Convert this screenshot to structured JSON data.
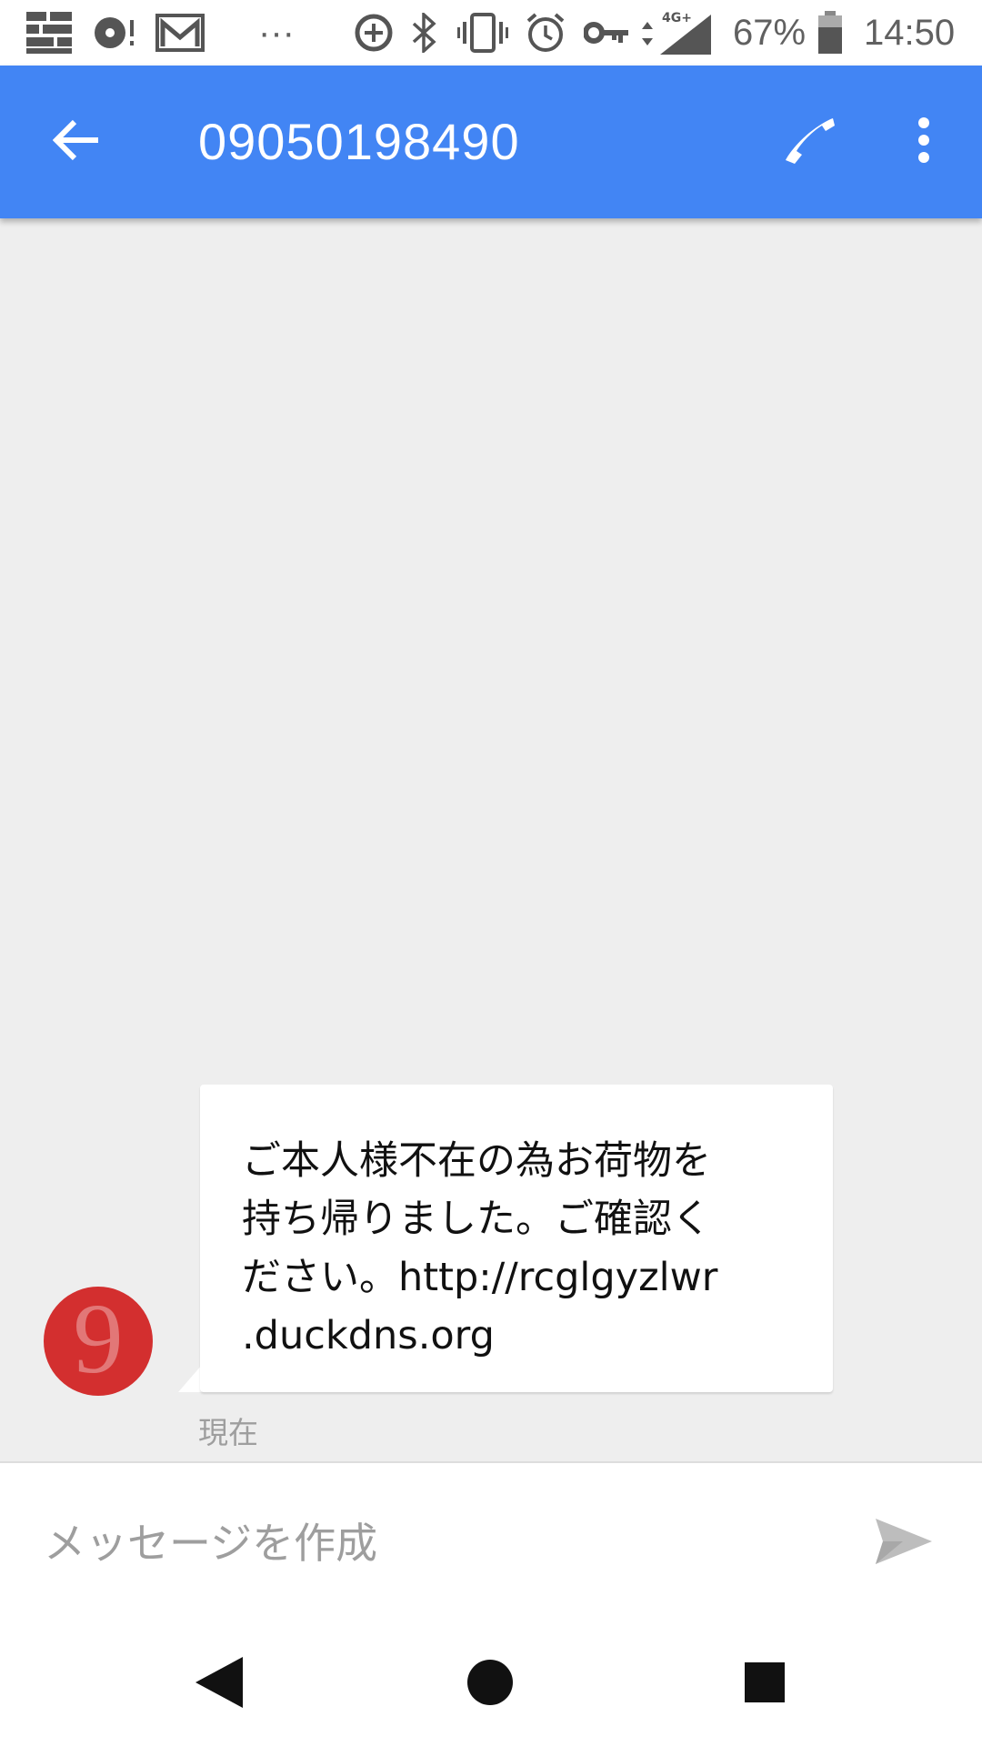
{
  "status_bar": {
    "battery_percent": "67%",
    "time": "14:50",
    "network": "4G+",
    "overflow": "···",
    "icons": [
      "grid-app-icon",
      "media-notification-icon",
      "gmail-icon",
      "data-saver-icon",
      "bluetooth-icon",
      "vibrate-icon",
      "alarm-icon",
      "vpn-key-icon",
      "signal-icon",
      "battery-icon"
    ]
  },
  "header": {
    "title": "09050198490"
  },
  "conversation": {
    "avatar_letter": "9",
    "avatar_color": "#d32f2f",
    "message_text": "ご本人様不在の為お荷物を\n持ち帰りました。ご確認く\nださい。http://rcglgyzlwr\n.duckdns.org",
    "timestamp": "現在"
  },
  "compose": {
    "placeholder": "メッセージを作成"
  },
  "colors": {
    "app_bar": "#4285f4",
    "background": "#eeeeee",
    "bubble": "#ffffff"
  }
}
